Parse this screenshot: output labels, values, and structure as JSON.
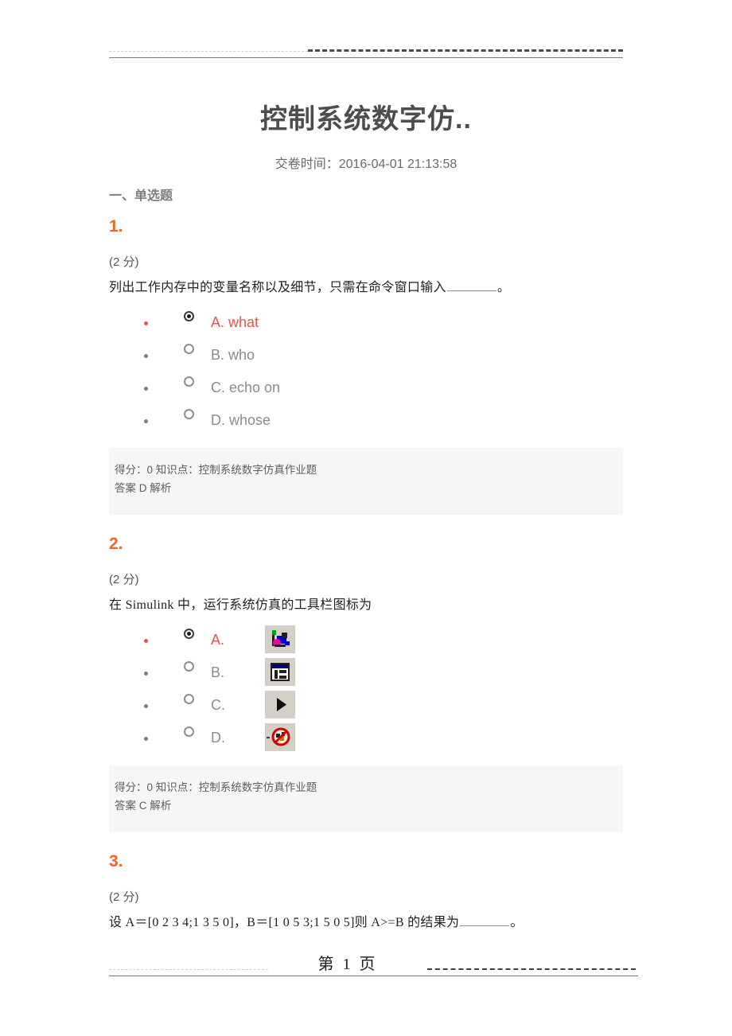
{
  "header": {
    "dash_left": "dashed-rule-light",
    "dash_right": "dashed-rule-dark"
  },
  "document": {
    "title": "控制系统数字仿..",
    "submit_time": "交卷时间：2016-04-01 21:13:58",
    "section_heading": "一、单选题"
  },
  "footer": {
    "page_label": "第 1 页"
  },
  "questions": [
    {
      "number": "1.",
      "score": "(2 分)",
      "stem_before": "列出工作内存中的变量名称以及细节，只需在命令窗口输入",
      "stem_after": "。",
      "options": [
        {
          "text": "A. what",
          "selected": true
        },
        {
          "text": "B. who",
          "selected": false
        },
        {
          "text": "C. echo on",
          "selected": false
        },
        {
          "text": "D. whose",
          "selected": false
        }
      ],
      "answer": {
        "line1": "得分：0 知识点：控制系统数字仿真作业题",
        "line2": "答案 D 解析"
      }
    },
    {
      "number": "2.",
      "score": "(2 分)",
      "stem_before": "在 Simulink 中，运行系统仿真的工具栏图标为",
      "stem_after": "",
      "options": [
        {
          "text": "A.",
          "icon": "simulink-library-icon",
          "selected": true
        },
        {
          "text": "B.",
          "icon": "model-window-icon",
          "selected": false
        },
        {
          "text": "C.",
          "icon": "run-play-icon",
          "selected": false
        },
        {
          "text": "D.",
          "icon": "stop-prohibited-icon",
          "selected": false
        }
      ],
      "answer": {
        "line1": "得分：0 知识点：控制系统数字仿真作业题",
        "line2": "答案 C 解析"
      }
    },
    {
      "number": "3.",
      "score": "(2 分)",
      "stem_before": "设 A＝[0 2 3 4;1 3 5 0]，B＝[1 0 5 3;1 5 0 5]则 A>=B 的结果为",
      "stem_after": "。",
      "options": [],
      "answer": null
    }
  ],
  "colors": {
    "accent_orange": "#f26522",
    "selected_red": "#e8534f",
    "muted_gray": "#8c8c8c",
    "answer_bg": "#f6f6f6"
  }
}
